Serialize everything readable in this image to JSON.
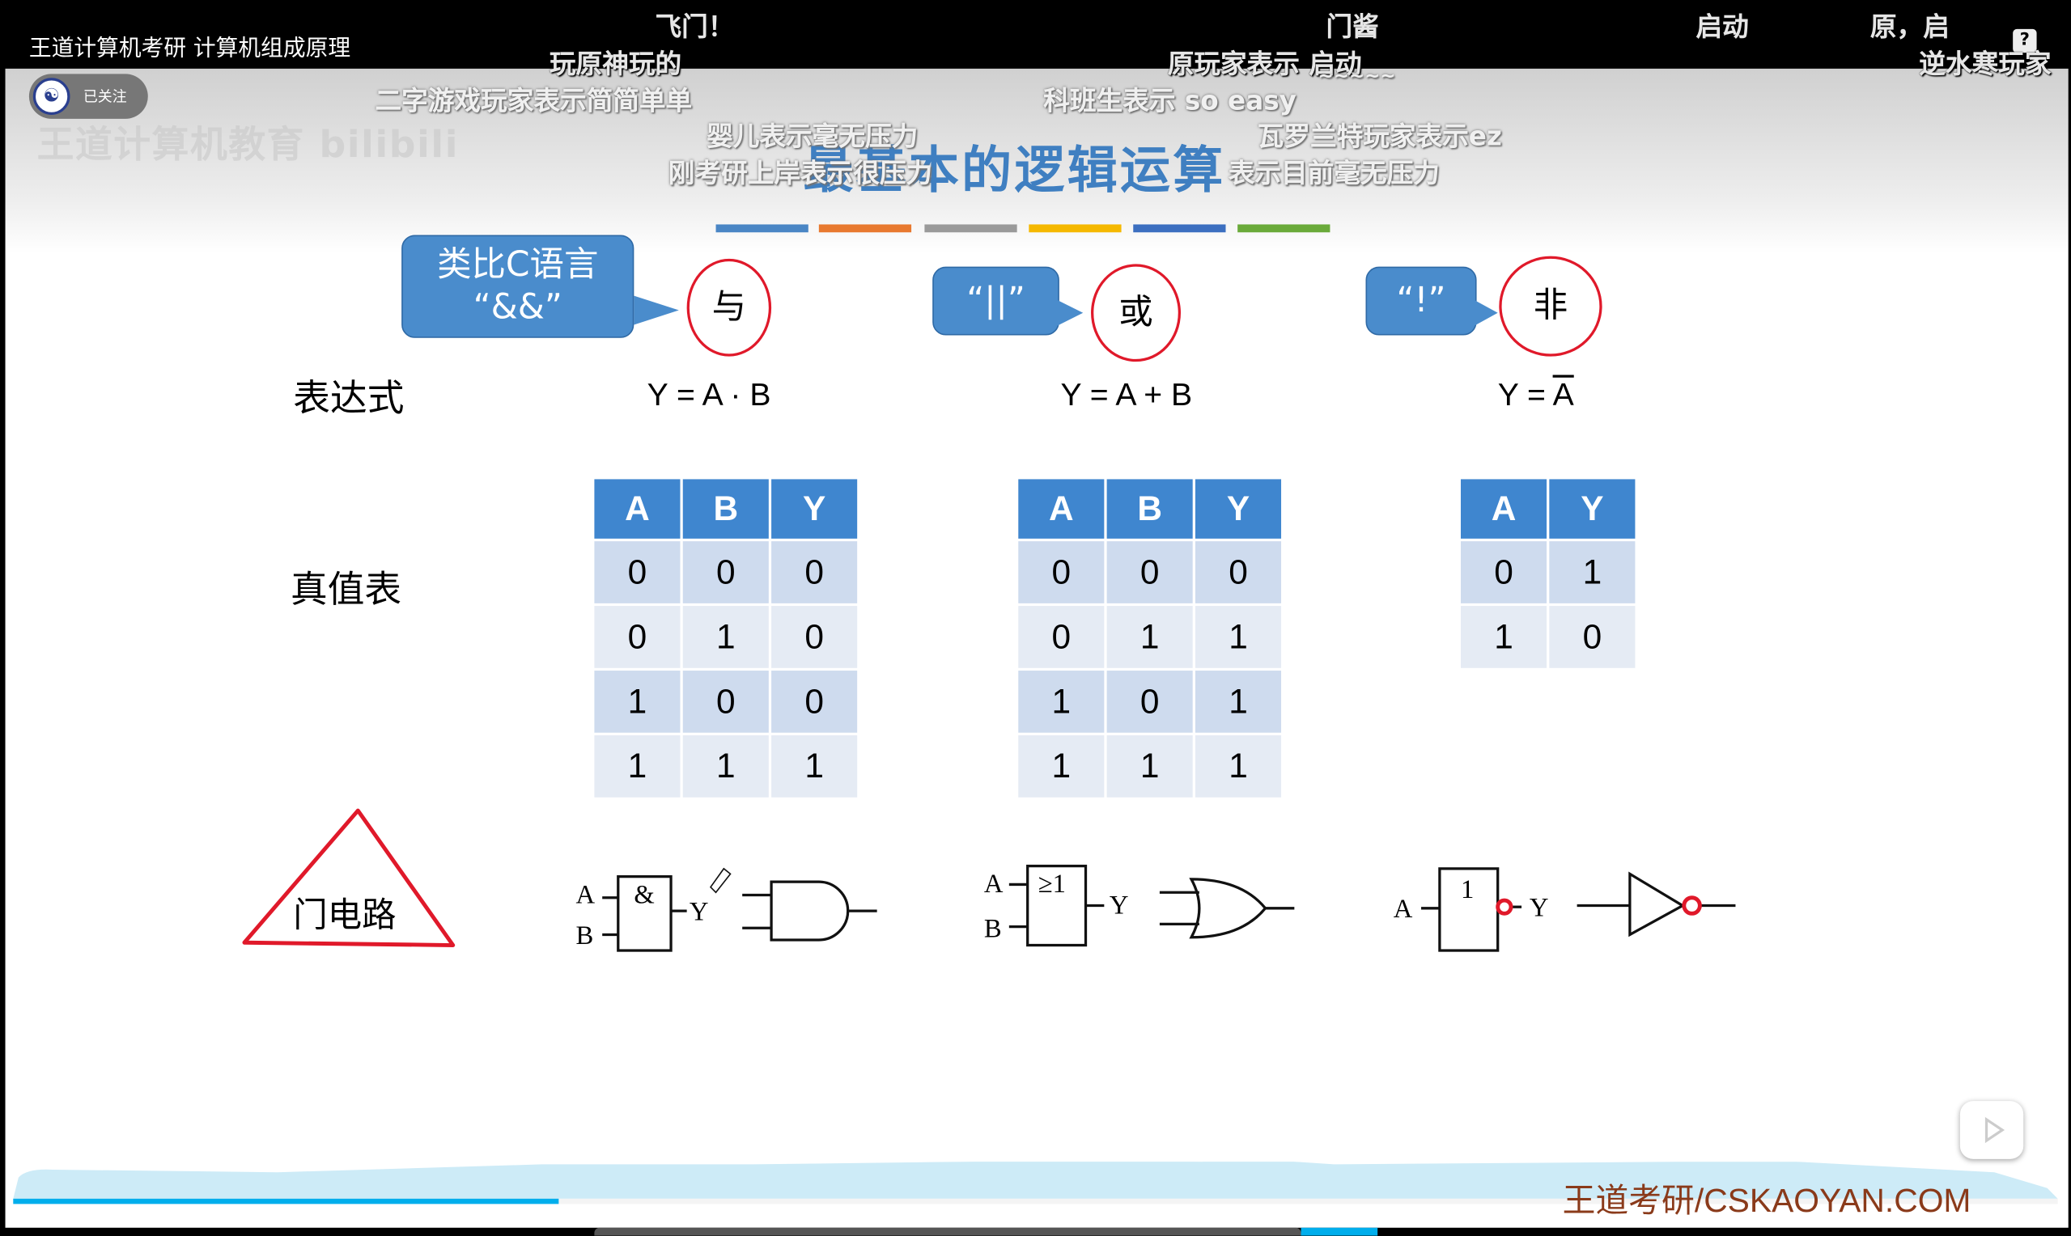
{
  "video": {
    "title": "王道计算机考研 计算机组成原理",
    "follow_label": "已关注",
    "watermark": "王道计算机教育 bilibili",
    "help": "?"
  },
  "danmaku": [
    "飞门！",
    "门酱",
    "启动",
    "原，启",
    "玩原神玩的",
    "原玩家表示 启动",
    "逆水寒玩家",
    "二字游戏玩家表示简简单单",
    "科班生表示 so easy",
    "~~~~~",
    "婴儿表示毫无压力",
    "瓦罗兰特玩家表示ez",
    "刚考研上岸表示很压力",
    "表示目前毫无压力"
  ],
  "slide": {
    "title": "最基本的逻辑运算",
    "bar_colors": [
      "#4a86c5",
      "#e8792f",
      "#9a9a9a",
      "#f5b800",
      "#3c6fc0",
      "#6aaa3a"
    ],
    "rows": {
      "expr": "表达式",
      "truth": "真值表",
      "gate": "门电路"
    },
    "ops": [
      {
        "bubble_line1": "类比C语言",
        "bubble_line2": "“&&”",
        "name": "与",
        "expr": "Y = A · B",
        "headers": [
          "A",
          "B",
          "Y"
        ],
        "rows": [
          [
            "0",
            "0",
            "0"
          ],
          [
            "0",
            "1",
            "0"
          ],
          [
            "1",
            "0",
            "0"
          ],
          [
            "1",
            "1",
            "1"
          ]
        ],
        "symbol": "&"
      },
      {
        "bubble_line1": "“||”",
        "name": "或",
        "expr": "Y = A + B",
        "headers": [
          "A",
          "B",
          "Y"
        ],
        "rows": [
          [
            "0",
            "0",
            "0"
          ],
          [
            "0",
            "1",
            "1"
          ],
          [
            "1",
            "0",
            "1"
          ],
          [
            "1",
            "1",
            "1"
          ]
        ],
        "symbol": "≥1"
      },
      {
        "bubble_line1": "“!”",
        "name": "非",
        "expr_prefix": "Y = ",
        "expr_var": "A",
        "headers": [
          "A",
          "Y"
        ],
        "rows": [
          [
            "0",
            "1"
          ],
          [
            "1",
            "0"
          ]
        ],
        "symbol": "1"
      }
    ],
    "gate_labels": {
      "a": "A",
      "b": "B",
      "y": "Y"
    },
    "brand": "王道考研/CSKAOYAN.COM"
  },
  "player": {
    "progress_fraction": 0.267
  }
}
